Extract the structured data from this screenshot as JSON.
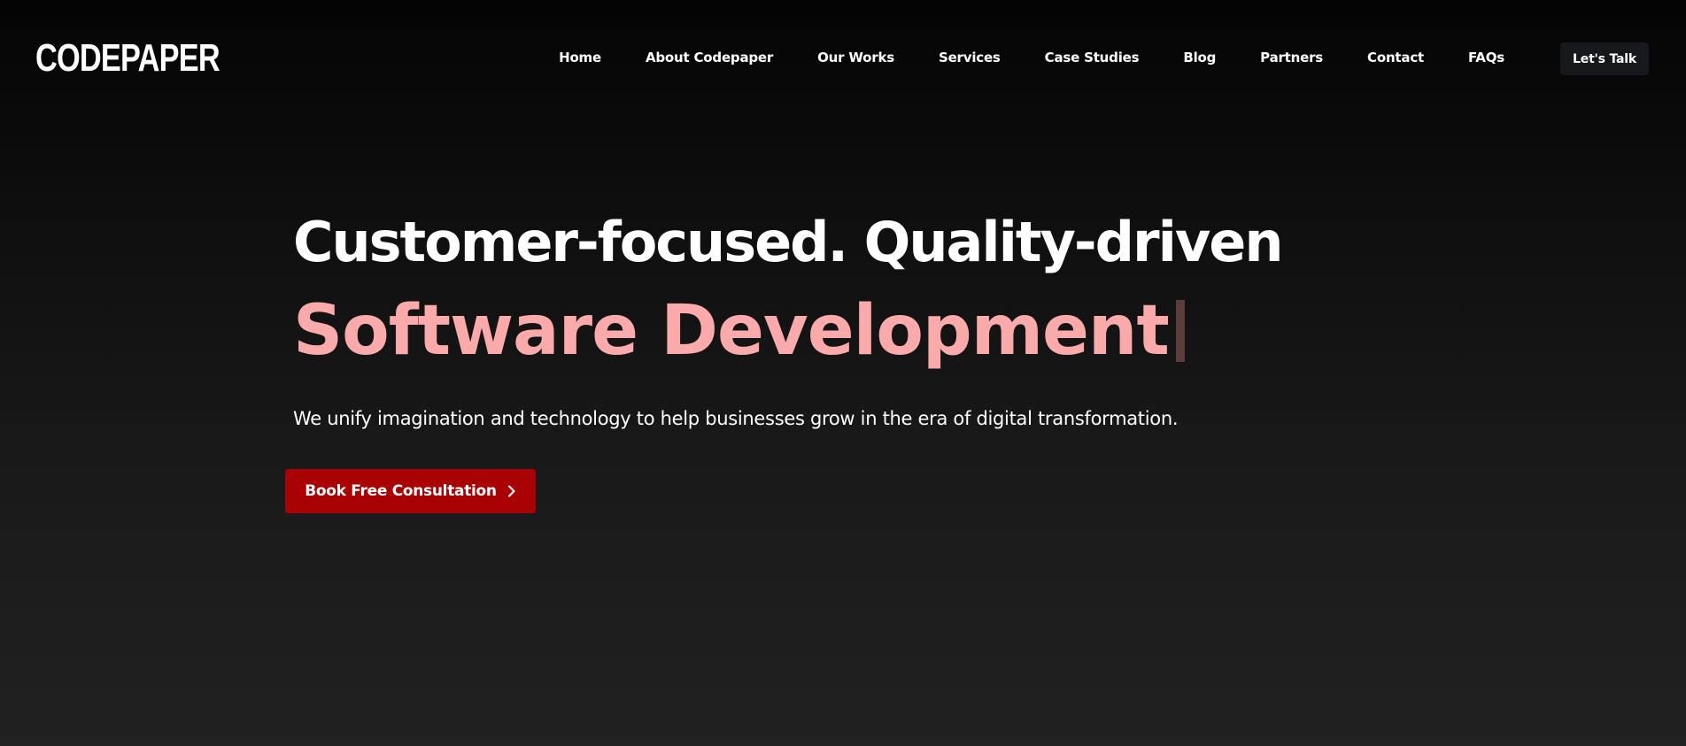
{
  "header": {
    "logo_text": "CODEPAPER",
    "nav": [
      {
        "label": "Home"
      },
      {
        "label": "About Codepaper"
      },
      {
        "label": "Our Works"
      },
      {
        "label": "Services"
      },
      {
        "label": "Case Studies"
      },
      {
        "label": "Blog"
      },
      {
        "label": "Partners"
      },
      {
        "label": "Contact"
      },
      {
        "label": "FAQs"
      }
    ],
    "cta_label": "Let's Talk"
  },
  "hero": {
    "title": "Customer-focused. Quality-driven",
    "accent": "Software Development",
    "subtitle": "We unify imagination and technology to help businesses grow in the era of digital transformation.",
    "button_label": "Book Free Consultation",
    "button_icon": "chevron-right-icon"
  },
  "colors": {
    "accent_text": "#fbaaab",
    "button_bg": "#a90205",
    "cta_bg": "#17181c",
    "background_top": "#040404",
    "background_bottom": "#212121"
  }
}
